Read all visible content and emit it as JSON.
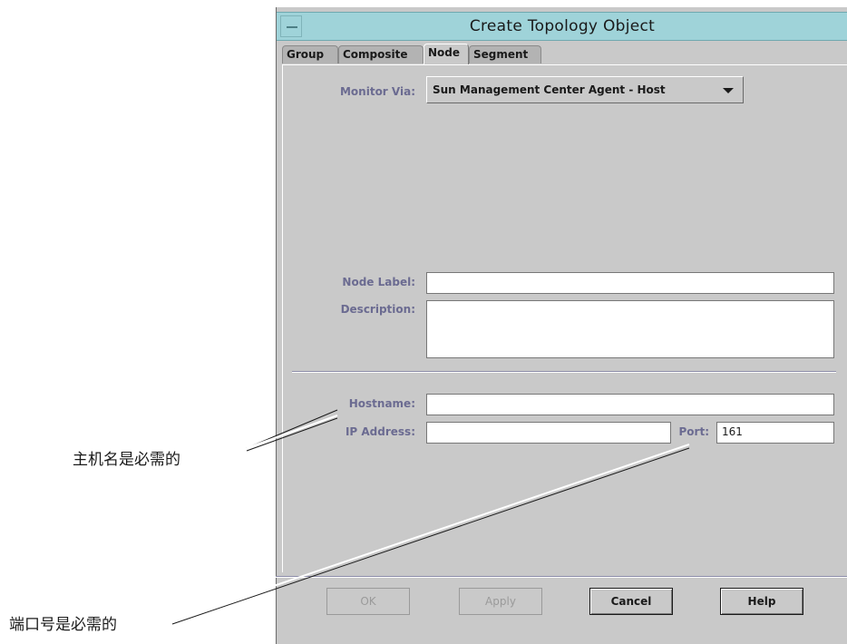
{
  "window": {
    "title": "Create Topology Object"
  },
  "tabs": [
    {
      "label": "Group"
    },
    {
      "label": "Composite"
    },
    {
      "label": "Node"
    },
    {
      "label": "Segment"
    }
  ],
  "form": {
    "monitor_via": {
      "label": "Monitor Via:",
      "value": "Sun Management Center Agent - Host"
    },
    "node_label": {
      "label": "Node Label:",
      "value": ""
    },
    "description": {
      "label": "Description:",
      "value": ""
    },
    "hostname": {
      "label": "Hostname:",
      "value": ""
    },
    "ip_address": {
      "label": "IP Address:",
      "value": ""
    },
    "port": {
      "label": "Port:",
      "value": "161"
    }
  },
  "buttons": {
    "ok": "OK",
    "apply": "Apply",
    "cancel": "Cancel",
    "help": "Help"
  },
  "callouts": {
    "hostname_required": "主机名是必需的",
    "port_required": "端口号是必需的"
  },
  "colors": {
    "titlebar": "#9fd3d9",
    "panel": "#c9c9c9",
    "label": "#6b6b91"
  }
}
